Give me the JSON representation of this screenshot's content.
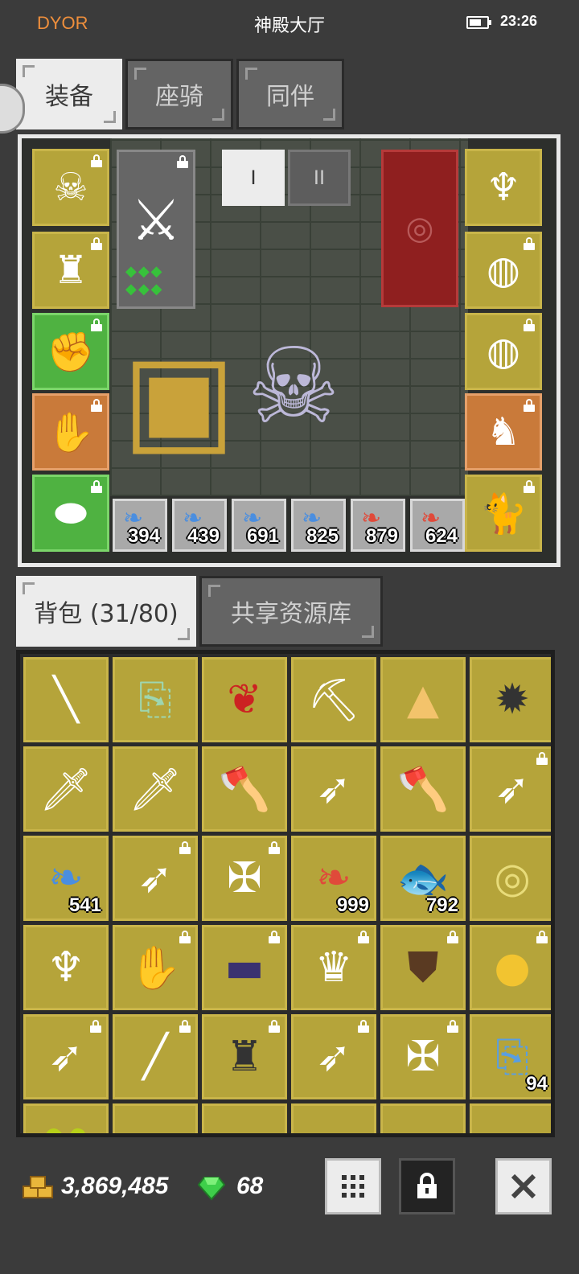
{
  "status_bar": {
    "left_label": "DYOR",
    "title": "神殿大厅",
    "time": "23:26"
  },
  "tabs": [
    {
      "label": "装备"
    },
    {
      "label": "座骑"
    },
    {
      "label": "同伴"
    }
  ],
  "equip": {
    "set_tabs": [
      {
        "label": "I"
      },
      {
        "label": "II"
      }
    ],
    "ammo": [
      {
        "count": "394",
        "color": "#4a8ee0"
      },
      {
        "count": "439",
        "color": "#4a8ee0"
      },
      {
        "count": "691",
        "color": "#4a8ee0"
      },
      {
        "count": "825",
        "color": "#4a8ee0"
      },
      {
        "count": "879",
        "color": "#e04a3a"
      },
      {
        "count": "624",
        "color": "#e04a3a"
      }
    ]
  },
  "bag_tabs": [
    {
      "label": "背包 (31/80)"
    },
    {
      "label": "共享资源库"
    }
  ],
  "bag": {
    "counts": {
      "r3c1": "541",
      "r3c4": "999",
      "r3c5": "792",
      "r5c6": "94"
    }
  },
  "footer": {
    "gold": "3,869,485",
    "gems": "68"
  }
}
